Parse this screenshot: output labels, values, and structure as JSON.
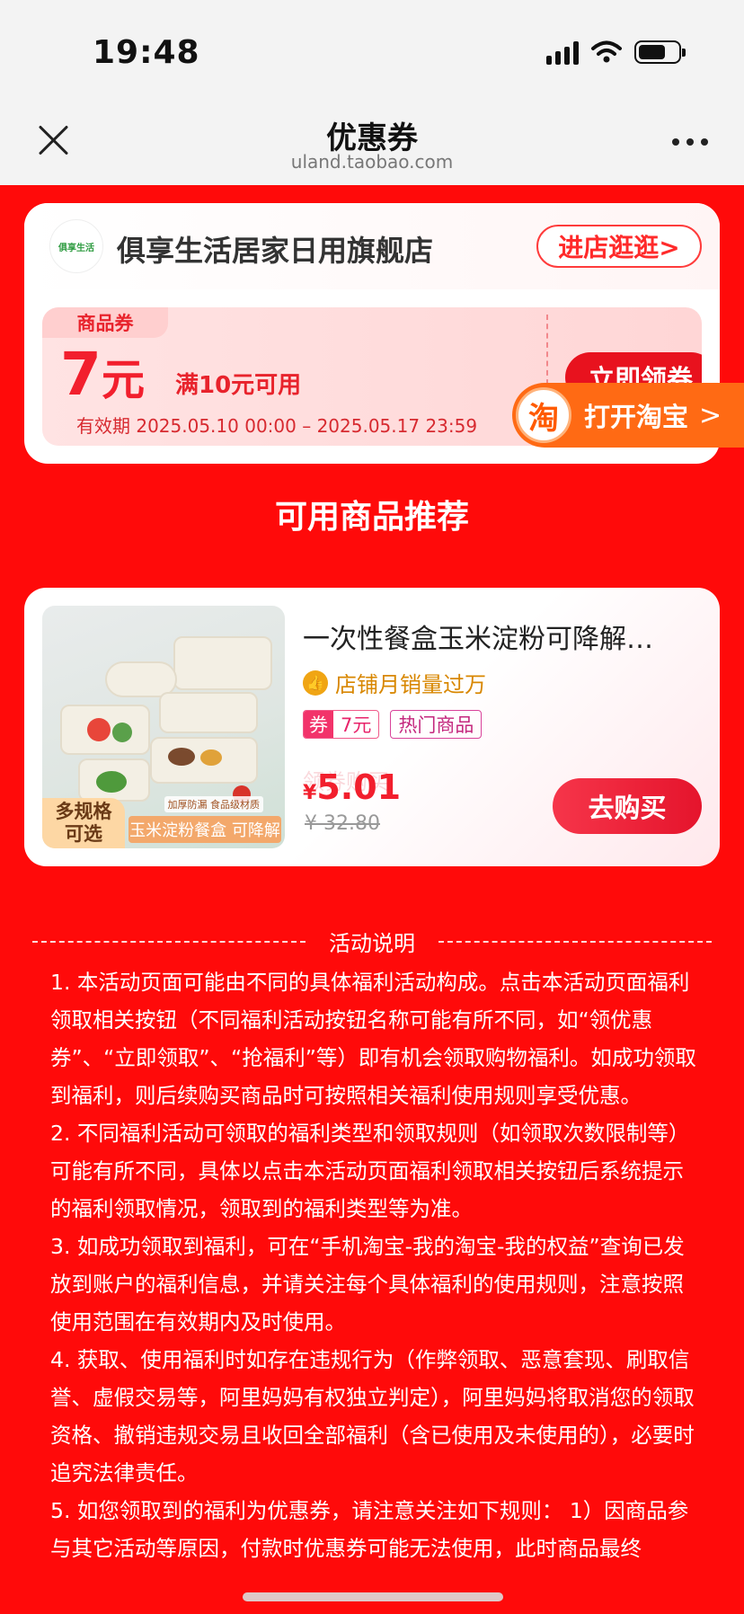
{
  "status": {
    "time": "19:48"
  },
  "nav": {
    "title": "优惠券",
    "subtitle": "uland.taobao.com"
  },
  "store": {
    "logo_text": "俱享生活",
    "name": "俱享生活居家日用旗舰店",
    "visit_label": "进店逛逛>"
  },
  "coupon": {
    "tag": "商品券",
    "amount": "7",
    "unit": "元",
    "condition": "满10元可用",
    "validity": "有效期 2025.05.10 00:00 – 2025.05.17 23:59",
    "claim_label": "立即领券"
  },
  "open_taobao": {
    "icon_char": "淘",
    "label": "打开淘宝",
    "arrow": ">"
  },
  "section_title": "可用商品推荐",
  "product": {
    "title": "一次性餐盒玉米淀粉可降解…",
    "sales": "店铺月销量过万",
    "tag_coupon_prefix": "券",
    "tag_coupon_value": "7元",
    "tag_hot": "热门商品",
    "spec_badge_line1": "多规格",
    "spec_badge_line2": "可选",
    "image_caption": "玉米淀粉餐盒 可降解",
    "image_note": "加厚防漏 食品级材质",
    "ghost_text": "领券购买",
    "price_symbol": "¥",
    "price_now": "5.01",
    "price_old": "¥ 32.80",
    "buy_label": "去购买"
  },
  "rules": {
    "title": "活动说明",
    "items": [
      "1. 本活动页面可能由不同的具体福利活动构成。点击本活动页面福利领取相关按钮（不同福利活动按钮名称可能有所不同，如“领优惠券”、“立即领取”、“抢福利”等）即有机会领取购物福利。如成功领取到福利，则后续购买商品时可按照相关福利使用规则享受优惠。",
      "2. 不同福利活动可领取的福利类型和领取规则（如领取次数限制等）可能有所不同，具体以点击本活动页面福利领取相关按钮后系统提示的福利领取情况，领取到的福利类型等为准。",
      "3. 如成功领取到福利，可在“手机淘宝-我的淘宝-我的权益”查询已发放到账户的福利信息，并请关注每个具体福利的使用规则，注意按照使用范围在有效期内及时使用。",
      "4. 获取、使用福利时如存在违规行为（作弊领取、恶意套现、刷取信誉、虚假交易等，阿里妈妈有权独立判定），阿里妈妈将取消您的领取资格、撤销违规交易且收回全部福利（含已使用及未使用的），必要时追究法律责任。",
      "5. 如您领取到的福利为优惠券，请注意关注如下规则： 1）因商品参与其它活动等原因，付款时优惠券可能无法使用，此时商品最终"
    ]
  },
  "colors": {
    "background": "#ff0a0a",
    "accent": "#e8121e",
    "taobao_orange": "#ff6a14"
  }
}
